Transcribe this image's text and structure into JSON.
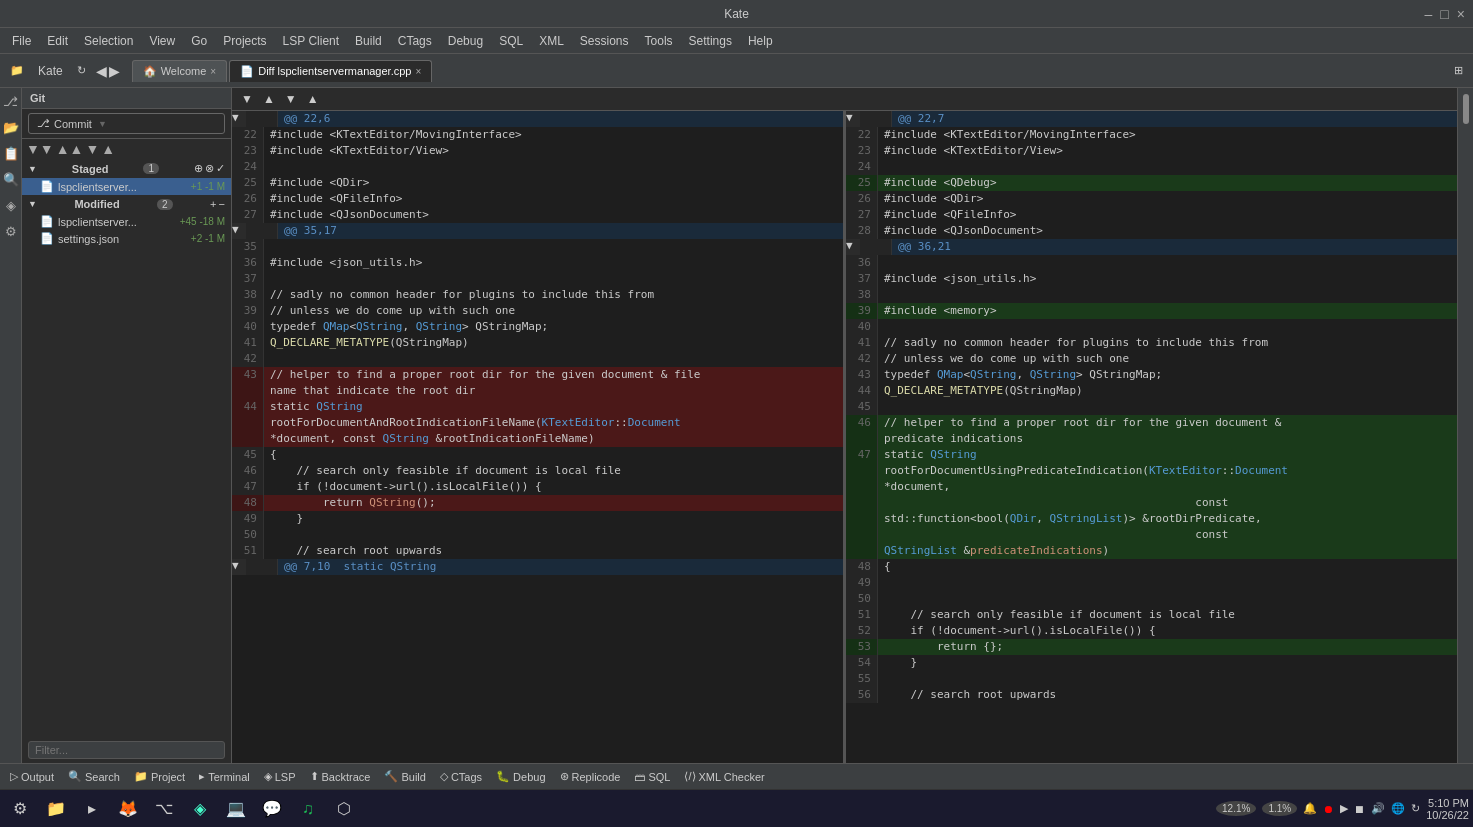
{
  "titleBar": {
    "title": "Kate",
    "windowControls": [
      "–",
      "□",
      "×"
    ]
  },
  "menuBar": {
    "items": [
      "File",
      "Edit",
      "Selection",
      "View",
      "Go",
      "Projects",
      "LSP Client",
      "Build",
      "CTags",
      "Debug",
      "SQL",
      "XML",
      "Sessions",
      "Tools",
      "Settings",
      "Help"
    ]
  },
  "toolbar": {
    "appName": "Kate",
    "tabs": [
      {
        "label": "Welcome",
        "icon": "🏠",
        "active": false,
        "closable": true
      },
      {
        "label": "Diff lspclientservermanager.cpp",
        "icon": "📄",
        "active": true,
        "closable": true
      }
    ]
  },
  "gitPanel": {
    "header": "Git",
    "commitBtn": "Commit",
    "staged": {
      "label": "Staged",
      "count": "1",
      "files": [
        {
          "name": "lspclientserver...",
          "changes": "+1 -1 M",
          "active": true
        }
      ]
    },
    "modified": {
      "label": "Modified",
      "count": "2",
      "files": [
        {
          "name": "lspclientserver...",
          "changes": "+45 -18 M"
        },
        {
          "name": "settings.json",
          "changes": "+2 -1 M"
        }
      ]
    },
    "filter": {
      "placeholder": "Filter..."
    }
  },
  "diffControls": {
    "buttons": [
      "▼",
      "▲",
      "▼",
      "▲"
    ]
  },
  "leftDiff": {
    "hunk1": {
      "header": "@@ 22,6",
      "lines": [
        {
          "num": "22",
          "content": "#include <KTextEditor/MovingInterface>",
          "type": "normal"
        },
        {
          "num": "23",
          "content": "#include <KTextEditor/View>",
          "type": "normal"
        },
        {
          "num": "24",
          "content": "",
          "type": "normal"
        },
        {
          "num": "25",
          "content": "#include <QDir>",
          "type": "normal"
        },
        {
          "num": "26",
          "content": "#include <QFileInfo>",
          "type": "normal"
        },
        {
          "num": "27",
          "content": "#include <QJsonDocument>",
          "type": "normal"
        }
      ]
    },
    "hunk2": {
      "header": "@@ 35,17",
      "lines": [
        {
          "num": "35",
          "content": "",
          "type": "normal"
        },
        {
          "num": "36",
          "content": "#include <json_utils.h>",
          "type": "normal"
        },
        {
          "num": "37",
          "content": "",
          "type": "normal"
        },
        {
          "num": "38",
          "content": "// sadly no common header for plugins to include this from",
          "type": "normal"
        },
        {
          "num": "39",
          "content": "// unless we do come up with such one",
          "type": "normal"
        },
        {
          "num": "40",
          "content": "typedef QMap<QString, QString> QStringMap;",
          "type": "normal"
        },
        {
          "num": "41",
          "content": "Q_DECLARE_METATYPE(QStringMap)",
          "type": "normal"
        },
        {
          "num": "42",
          "content": "",
          "type": "normal"
        },
        {
          "num": "43",
          "content": "// helper to find a proper root dir for the given document & file",
          "type": "removed"
        },
        {
          "num": "",
          "content": "name that indicate the root dir",
          "type": "removed"
        },
        {
          "num": "44",
          "content": "static QString",
          "type": "removed"
        },
        {
          "num": "",
          "content": "rootForDocumentAndRootIndicationFileName(KTextEditor::Document",
          "type": "removed"
        },
        {
          "num": "",
          "content": "*document, const QString &rootIndicationFileName)",
          "type": "removed"
        },
        {
          "num": "45",
          "content": "{",
          "type": "normal"
        },
        {
          "num": "46",
          "content": "    // search only feasible if document is local file",
          "type": "normal"
        },
        {
          "num": "47",
          "content": "    if (!document->url().isLocalFile()) {",
          "type": "normal"
        },
        {
          "num": "48",
          "content": "        return QString();",
          "type": "removed"
        },
        {
          "num": "49",
          "content": "    }",
          "type": "normal"
        },
        {
          "num": "50",
          "content": "",
          "type": "normal"
        },
        {
          "num": "51",
          "content": "    // search root upwards",
          "type": "normal"
        }
      ]
    }
  },
  "rightDiff": {
    "hunk1": {
      "header": "@@ 22,7",
      "lines": [
        {
          "num": "22",
          "content": "#include <KTextEditor/MovingInterface>",
          "type": "normal"
        },
        {
          "num": "23",
          "content": "#include <KTextEditor/View>",
          "type": "normal"
        },
        {
          "num": "24",
          "content": "",
          "type": "normal"
        },
        {
          "num": "25",
          "content": "#include <QDebug>",
          "type": "added"
        },
        {
          "num": "26",
          "content": "#include <QDir>",
          "type": "normal"
        },
        {
          "num": "27",
          "content": "#include <QFileInfo>",
          "type": "normal"
        },
        {
          "num": "28",
          "content": "#include <QJsonDocument>",
          "type": "normal"
        }
      ]
    },
    "hunk2": {
      "header": "@@ 36,21",
      "lines": [
        {
          "num": "36",
          "content": "",
          "type": "normal"
        },
        {
          "num": "37",
          "content": "#include <json_utils.h>",
          "type": "normal"
        },
        {
          "num": "38",
          "content": "",
          "type": "normal"
        },
        {
          "num": "39",
          "content": "#include <memory>",
          "type": "added"
        },
        {
          "num": "40",
          "content": "",
          "type": "normal"
        },
        {
          "num": "41",
          "content": "// sadly no common header for plugins to include this from",
          "type": "normal"
        },
        {
          "num": "42",
          "content": "// unless we do come up with such one",
          "type": "normal"
        },
        {
          "num": "43",
          "content": "typedef QMap<QString, QString> QStringMap;",
          "type": "normal"
        },
        {
          "num": "44",
          "content": "Q_DECLARE_METATYPE(QStringMap)",
          "type": "normal"
        },
        {
          "num": "45",
          "content": "",
          "type": "normal"
        },
        {
          "num": "46",
          "content": "// helper to find a proper root dir for the given document &",
          "type": "added"
        },
        {
          "num": "",
          "content": "predicate indications",
          "type": "added"
        },
        {
          "num": "47",
          "content": "static QString",
          "type": "added"
        },
        {
          "num": "",
          "content": "rootForDocumentUsingPredicateIndication(KTextEditor::Document",
          "type": "added"
        },
        {
          "num": "",
          "content": "*document,",
          "type": "added"
        },
        {
          "num": "",
          "content": "                                               const",
          "type": "added"
        },
        {
          "num": "",
          "content": "std::function<bool(QDir, QStringList)> &rootDirPredicate,",
          "type": "added"
        },
        {
          "num": "",
          "content": "                                               const",
          "type": "added"
        },
        {
          "num": "",
          "content": "QStringList &predicateIndications)",
          "type": "added"
        },
        {
          "num": "48",
          "content": "{",
          "type": "normal"
        },
        {
          "num": "49",
          "content": "",
          "type": "normal"
        },
        {
          "num": "50",
          "content": "",
          "type": "normal"
        },
        {
          "num": "51",
          "content": "    // search only feasible if document is local file",
          "type": "normal"
        },
        {
          "num": "52",
          "content": "    if (!document->url().isLocalFile()) {",
          "type": "normal"
        },
        {
          "num": "53",
          "content": "        return {};",
          "type": "added"
        },
        {
          "num": "54",
          "content": "    }",
          "type": "normal"
        },
        {
          "num": "55",
          "content": "",
          "type": "normal"
        },
        {
          "num": "56",
          "content": "    // search root upwards",
          "type": "normal"
        }
      ]
    }
  },
  "bottomToolbar": {
    "items": [
      "Output",
      "Search",
      "Project",
      "Terminal",
      "LSP",
      "Backtrace",
      "Build",
      "CTags",
      "Debug",
      "Replicode",
      "SQL",
      "XML Checker"
    ]
  },
  "taskbar": {
    "time": "5:10 PM",
    "date": "10/26/22",
    "cpuLeft": "12.1%",
    "cpuRight": "1.1%"
  }
}
